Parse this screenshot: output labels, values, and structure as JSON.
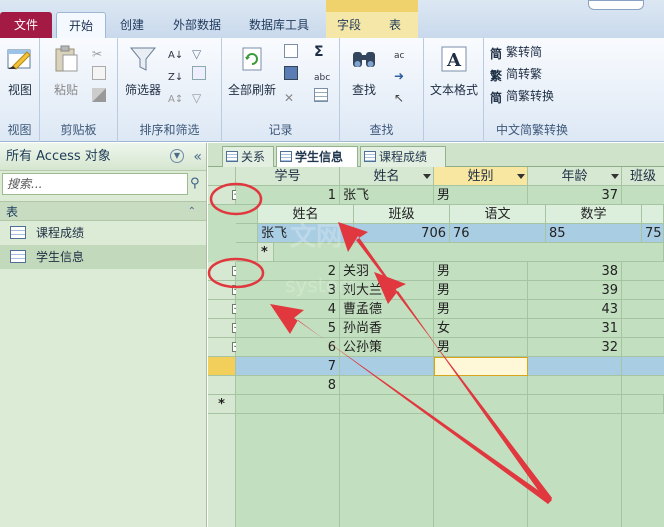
{
  "ribbon": {
    "tabs": {
      "file": "文件",
      "home": "开始",
      "create": "创建",
      "external": "外部数据",
      "dbtools": "数据库工具",
      "fields": "字段",
      "table": "表"
    },
    "groups": {
      "views": {
        "label": "视图",
        "view_button": "视图"
      },
      "clipboard": {
        "label": "剪贴板",
        "paste_button": "粘贴"
      },
      "sortfilter": {
        "label": "排序和筛选",
        "filter_button": "筛选器"
      },
      "records": {
        "label": "记录",
        "refresh_button": "全部刷新"
      },
      "find": {
        "label": "查找",
        "find_button": "查找"
      },
      "textformat": {
        "label": "文本格式",
        "sigma": "Σ"
      },
      "chinese": {
        "label": "中文简繁转换",
        "to_simplified": "繁转简",
        "to_traditional": "简转繁",
        "convert": "简繁转换",
        "glyph1": "简",
        "glyph2": "繁",
        "glyph3": "简"
      }
    }
  },
  "nav": {
    "header": "所有 Access 对象",
    "search_placeholder": "搜索...",
    "group_label": "表",
    "items": [
      "课程成绩",
      "学生信息"
    ]
  },
  "doc_tabs": [
    "关系",
    "学生信息",
    "课程成绩"
  ],
  "grid": {
    "columns": [
      "学号",
      "姓名",
      "姓别",
      "年龄",
      "班级"
    ],
    "rows": [
      {
        "id": "1",
        "name": "张飞",
        "gender": "男",
        "age": "37"
      },
      {
        "id": "2",
        "name": "关羽",
        "gender": "男",
        "age": "38"
      },
      {
        "id": "3",
        "name": "刘大兰",
        "gender": "男",
        "age": "39"
      },
      {
        "id": "4",
        "name": "曹孟德",
        "gender": "男",
        "age": "43"
      },
      {
        "id": "5",
        "name": "孙尚香",
        "gender": "女",
        "age": "31"
      },
      {
        "id": "6",
        "name": "公孙策",
        "gender": "男",
        "age": "32"
      },
      {
        "id": "7",
        "name": "",
        "gender": "",
        "age": ""
      },
      {
        "id": "8",
        "name": "",
        "gender": "",
        "age": ""
      }
    ],
    "subdatasheet": {
      "columns": [
        "姓名",
        "班级",
        "语文",
        "数学",
        ""
      ],
      "row": {
        "name": "张飞",
        "class": "706",
        "chinese": "76",
        "math": "85",
        "extra": "75"
      }
    },
    "new_row_marker": "*"
  },
  "watermark": {
    "text": "system",
    "logo_text": "文网"
  },
  "annotation_color": "#e0383e"
}
